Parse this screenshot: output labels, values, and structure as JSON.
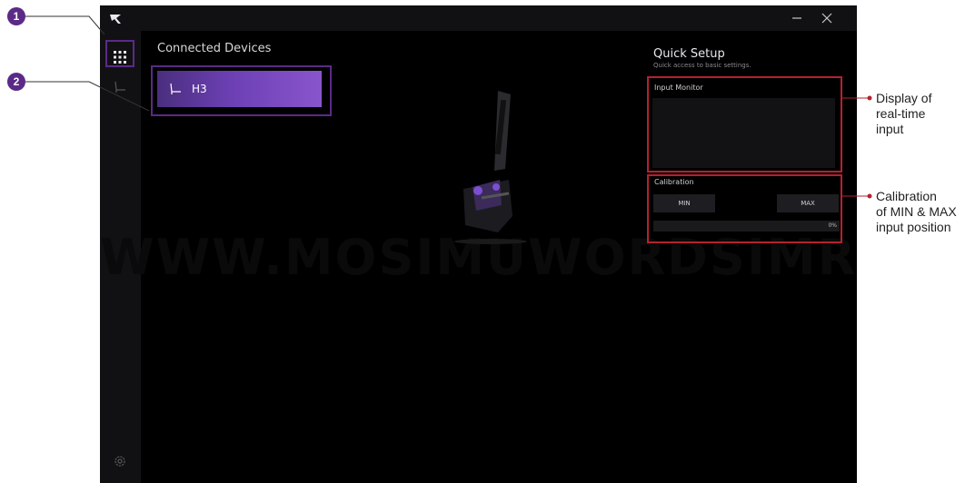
{
  "app": {
    "logo_icon": "r-logo-icon",
    "window": {
      "minimize_icon": "minimize-icon",
      "close_icon": "close-icon"
    },
    "sidebar": [
      "home-grid-icon",
      "seat-icon",
      "gear-icon"
    ]
  },
  "main": {
    "connected_title": "Connected Devices",
    "device": {
      "name": "H3",
      "icon": "seat-icon"
    },
    "watermark": "WWW.MOSIMUWORDSIMRACE.COM"
  },
  "quick_setup": {
    "title": "Quick Setup",
    "subtitle": "Quick access to basic settings.",
    "input_monitor_label": "Input Monitor",
    "calibration_label": "Calibration",
    "min_label": "MIN",
    "max_label": "MAX",
    "progress_text": "0%",
    "progress_value": 0
  },
  "callouts": {
    "marker_1": "1",
    "marker_2": "2",
    "display_note": [
      "Display of",
      "real-time",
      "input"
    ],
    "calibration_note": [
      "Calibration",
      "of MIN & MAX",
      "input position"
    ]
  },
  "colors": {
    "accent": "#6c40b4",
    "highlight_purple": "#5b2a86",
    "highlight_red": "#b3222e"
  }
}
